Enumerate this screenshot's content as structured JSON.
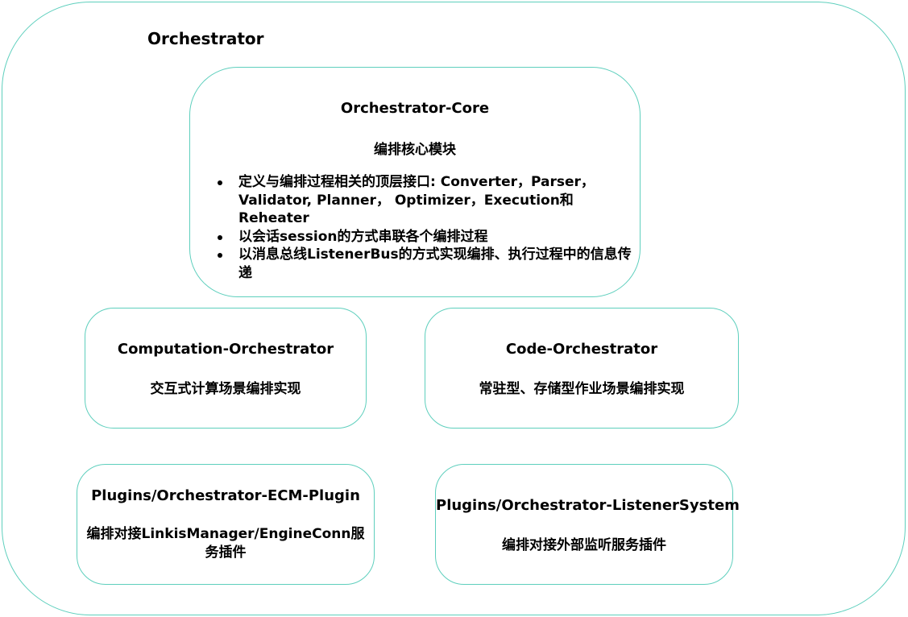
{
  "outer": {
    "title": "Orchestrator"
  },
  "core": {
    "title": "Orchestrator-Core",
    "subtitle": "编排核心模块",
    "bullets": [
      "定义与编排过程相关的顶层接口: Converter，Parser，Validator, Planner， Optimizer，Execution和Reheater",
      "以会话session的方式串联各个编排过程",
      "以消息总线ListenerBus的方式实现编排、执行过程中的信息传递"
    ]
  },
  "computation": {
    "title": "Computation-Orchestrator",
    "subtitle": "交互式计算场景编排实现"
  },
  "code": {
    "title": "Code-Orchestrator",
    "subtitle": "常驻型、存储型作业场景编排实现"
  },
  "ecm_plugin": {
    "title": "Plugins/Orchestrator-ECM-Plugin",
    "subtitle": "编排对接LinkisManager/EngineConn服务插件"
  },
  "listener_system": {
    "title": "Plugins/Orchestrator-ListenerSystem",
    "subtitle": "编排对接外部监听服务插件"
  },
  "colors": {
    "border": "#5ecfbd",
    "text": "#000000",
    "background": "#ffffff"
  }
}
